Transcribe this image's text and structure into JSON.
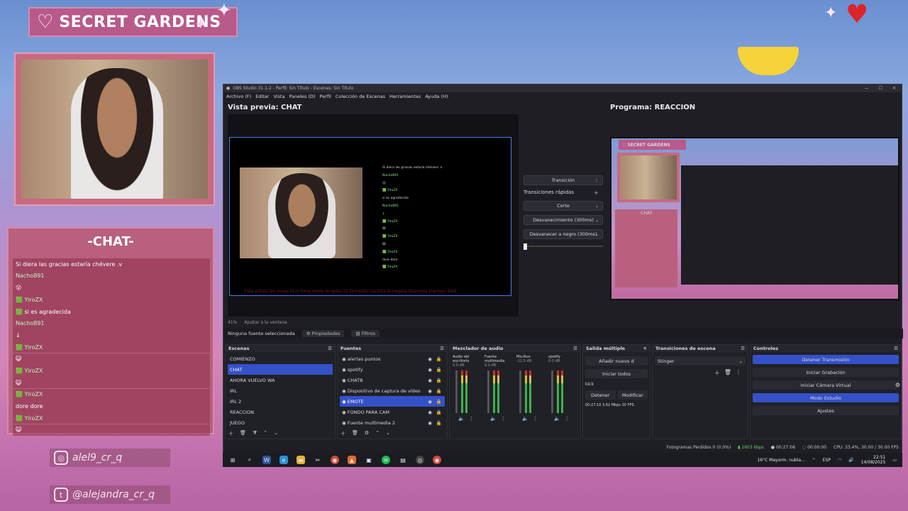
{
  "overlay": {
    "title": "SECRET GARDENS",
    "chat_title": "-CHAT-",
    "chat_rows": [
      {
        "text": "Si diera las gracias estaría chévere .v",
        "user": false
      },
      {
        "text": "Nacho891",
        "user": true
      },
      {
        "text": "😮",
        "user": false
      },
      {
        "text": "🟩 YiroZX",
        "user": true
      },
      {
        "text": "🟩 si es agradecida",
        "user": false
      },
      {
        "text": "Nacho891",
        "user": true
      },
      {
        "text": "↓",
        "user": false
      },
      {
        "text": "🟩 YiroZX",
        "user": true
      },
      {
        "text": "😺",
        "user": false
      },
      {
        "text": "🟩 YiroZX",
        "user": true
      },
      {
        "text": "😺",
        "user": false
      },
      {
        "text": "🟩 YiroZX",
        "user": true
      },
      {
        "text": "dore dore",
        "user": false
      },
      {
        "text": "🟩 YiroZX",
        "user": true
      },
      {
        "text": "😺",
        "user": false
      }
    ],
    "instagram": "alel9_cr_q",
    "tiktok": "@alejandra_cr_q"
  },
  "obs": {
    "window_title": "OBS Studio 31.1.2 - Perfil: Sin Título - Escenas: Sin Título",
    "menu": [
      "Archivo (F)",
      "Editar",
      "Vista",
      "Paneles (D)",
      "Perfil",
      "Colección de Escenas",
      "Herramientas",
      "Ayuda (H)"
    ],
    "preview_label": "Vista previa: CHAT",
    "program_label": "Programa: REACCION",
    "preview_chat": [
      {
        "t": "Si diera las gracias estaría chévere .v",
        "u": false
      },
      {
        "t": "Nacho891",
        "u": true
      },
      {
        "t": "😮",
        "u": false
      },
      {
        "t": "🟩 YiroZX",
        "u": true
      },
      {
        "t": "si es agradecida",
        "u": false
      },
      {
        "t": "Nacho891",
        "u": true
      },
      {
        "t": "↓",
        "u": false
      },
      {
        "t": "🟩 YiroZX",
        "u": true
      },
      {
        "t": "😺",
        "u": false
      },
      {
        "t": "🟩 YiroZX",
        "u": true
      },
      {
        "t": "😺",
        "u": false
      },
      {
        "t": "🟩 YiroZX",
        "u": true
      },
      {
        "t": "dore dore",
        "u": false
      },
      {
        "t": "🟩 YiroZX",
        "u": true
      }
    ],
    "preview_ticker": "Esta activo las voces hlux hirox lelmo le igoku liz ilsmaster liacinta le negeta lilsamela lilarmon lbed",
    "transitions": {
      "transition_btn": "Transición",
      "quick_label": "Transiciones rápidas",
      "items": [
        "Corte",
        "Desvanecimiento (300ms)",
        "Desvanecer a negro (300ms)"
      ]
    },
    "zoom": [
      "41%",
      "Ajustar a la ventana"
    ],
    "source_bar": {
      "none": "Ninguna fuente seleccionada",
      "props": "Propiedades",
      "filters": "Filtros"
    },
    "scenes": {
      "title": "Escenas",
      "items": [
        "COMIENZO",
        "CHAT",
        "AHORA VUELVO WA",
        "IRL",
        "IRL 2",
        "REACCION",
        "JUEGO"
      ],
      "selected": 1
    },
    "sources": {
      "title": "Fuentes",
      "items": [
        "alertas puntos",
        "spotify",
        "CHATB",
        "Dispositivo de captura de vídeo",
        "EMOTE",
        "FONDO PARA CAM",
        "Fuente multimedia 2"
      ],
      "selected": 4
    },
    "mixer": {
      "title": "Mezclador de audio",
      "channels": [
        {
          "name": "Audio del escritorio",
          "db": "0.0 dB"
        },
        {
          "name": "Fuente multimedia",
          "db": "0.0 dB"
        },
        {
          "name": "Mic/Aux",
          "db": "-11.5 dB"
        },
        {
          "name": "spotify",
          "db": "0.0 dB"
        }
      ]
    },
    "multi_out": {
      "title": "Salida múltiple",
      "add": "Añadir nuevo d",
      "start_all": "Iniciar todos",
      "kick": "kick",
      "stop": "Detener",
      "modify": "Modificar",
      "stats": "00:27:10  3.62 Mbps  30 FPS"
    },
    "scene_trans": {
      "title": "Transiciones de escena",
      "value": "Stinger"
    },
    "controls": {
      "title": "Controles",
      "items": [
        "Detener Transmisión",
        "Iniciar Grabación",
        "Iniciar Cámara Virtual",
        "Modo Estudio",
        "Ajustes"
      ]
    },
    "status": {
      "dropped": "Fotogramas Perdidos 0 (0.0%)",
      "bitrate": "2603 kbps",
      "time1": "00:27:08",
      "time2": "00:00:00",
      "cpu": "CPU: 33.4%, 30.00 / 30.00 FPS"
    }
  },
  "taskbar": {
    "weather": "16°C  Mayorm. nubla...",
    "lang": "ESP",
    "time": "22:51",
    "date": "14/08/2025"
  }
}
